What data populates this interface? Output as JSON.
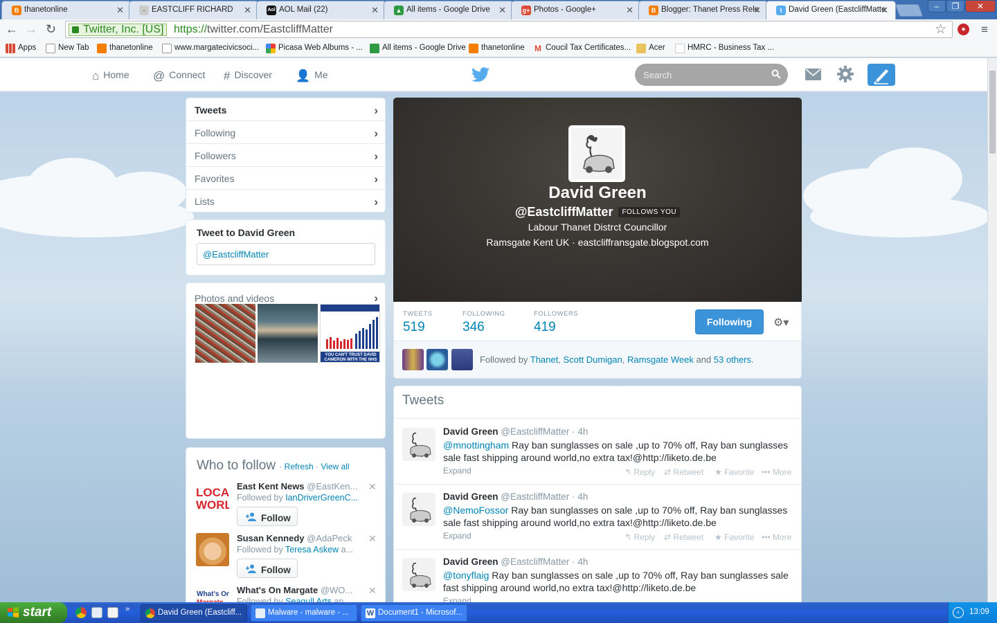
{
  "browser": {
    "tabs": [
      {
        "label": "thanetonline",
        "color": "#f57d00",
        "glyph": "B"
      },
      {
        "label": "EASTCLIFF RICHARD",
        "color": "#999999",
        "glyph": "▫"
      },
      {
        "label": "AOL Mail (22)",
        "color": "#111111",
        "glyph": "Aol"
      },
      {
        "label": "All items - Google Drive",
        "color": "#2f9a44",
        "glyph": "▲"
      },
      {
        "label": "Photos - Google+",
        "color": "#dd4b39",
        "glyph": "g+"
      },
      {
        "label": "Blogger: Thanet Press Rele",
        "color": "#f57d00",
        "glyph": "B"
      },
      {
        "label": "David Green (EastcliffMatte",
        "color": "#55acee",
        "glyph": "t"
      }
    ],
    "ev_label": "Twitter, Inc. [US]",
    "url_scheme": "https://",
    "url_rest": "twitter.com/EastcliffMatter",
    "bookmarks": [
      {
        "label": "Apps",
        "color": "#d84a38"
      },
      {
        "label": "New Tab",
        "color": "#ffffff"
      },
      {
        "label": "thanetonline",
        "color": "#f57d00"
      },
      {
        "label": "www.margatecivicsoci...",
        "color": "#ffffff"
      },
      {
        "label": "Picasa Web Albums - ...",
        "color": "#8a4ebd"
      },
      {
        "label": "All items - Google Drive",
        "color": "#2f9a44"
      },
      {
        "label": "thanetonline",
        "color": "#f57d00"
      },
      {
        "label": "Coucil Tax Certificates...",
        "color": "#d44638"
      },
      {
        "label": "Acer",
        "color": "#e8c35e"
      },
      {
        "label": "HMRC - Business Tax ...",
        "color": "#ffffff"
      }
    ]
  },
  "twitter": {
    "nav": {
      "home": "Home",
      "connect": "Connect",
      "discover": "Discover",
      "me": "Me"
    },
    "search_placeholder": "Search",
    "colors": {
      "link": "#0084b4",
      "accent": "#3b94d9"
    }
  },
  "sidebar": {
    "items": [
      "Tweets",
      "Following",
      "Followers",
      "Favorites",
      "Lists"
    ],
    "tweet_to_title": "Tweet to David Green",
    "tweet_to_value": "@EastcliffMatter",
    "photos_title": "Photos and videos",
    "photo_text": "YOU CAN'T TRUST DAVID CAMERON WITH THE NHS",
    "wtf": {
      "title": "Who to follow",
      "refresh": "Refresh",
      "view_all": "View all",
      "follow_label": "Follow",
      "items": [
        {
          "name": "East Kent News",
          "handle": "@EastKen...",
          "followed_prefix": "Followed by",
          "followed_by": "IanDriverGreenC..."
        },
        {
          "name": "Susan Kennedy",
          "handle": "@AdaPeck",
          "followed_prefix": "Followed by",
          "followed_by": "Teresa Askew",
          "followed_suffix": "a..."
        },
        {
          "name": "What's On Margate",
          "handle": "@WO...",
          "followed_prefix": "Followed by",
          "followed_by": "Seagull Arts",
          "followed_suffix": "an..."
        }
      ]
    }
  },
  "profile": {
    "name": "David Green",
    "handle": "@EastcliffMatter",
    "follows_you": "FOLLOWS YOU",
    "bio": "Labour Thanet Distrct Councillor",
    "location": "Ramsgate Kent UK",
    "website": "eastcliffransgate.blogspot.com",
    "stats": {
      "tweets_label": "TWEETS",
      "tweets": "519",
      "following_label": "FOLLOWING",
      "following": "346",
      "followers_label": "FOLLOWERS",
      "followers": "419"
    },
    "following_button": "Following",
    "followed_by": {
      "prefix": "Followed by",
      "a": "Thanet",
      "b": "Scott Dumigan",
      "c": "Ramsgate Week",
      "and": "and",
      "others": "53 others"
    }
  },
  "tweets": {
    "title": "Tweets",
    "actions": {
      "expand": "Expand",
      "reply": "Reply",
      "retweet": "Retweet",
      "favorite": "Favorite",
      "more": "More"
    },
    "items": [
      {
        "name": "David Green",
        "handle": "@EastcliffMatter",
        "time": "4h",
        "mention": "@mnottingham",
        "text": " Ray ban sunglasses on sale ,up to 70% off, Ray ban sunglasses sale fast shipping around world,no extra tax!@http://liketo.de.be"
      },
      {
        "name": "David Green",
        "handle": "@EastcliffMatter",
        "time": "4h",
        "mention": "@NemoFossor",
        "text": " Ray ban sunglasses on sale ,up to 70% off, Ray ban sunglasses sale fast shipping around world,no extra tax!@http://liketo.de.be"
      },
      {
        "name": "David Green",
        "handle": "@EastcliffMatter",
        "time": "4h",
        "mention": "@tonyflaig",
        "text": " Ray ban sunglasses on sale ,up to 70% off, Ray ban sunglasses sale fast shipping around world,no extra tax!@http://liketo.de.be"
      }
    ]
  },
  "taskbar": {
    "start": "start",
    "items": [
      "David Green (Eastcliff...",
      "Malware - malware - ...",
      "Document1 - Microsof..."
    ],
    "clock": "13:09"
  }
}
